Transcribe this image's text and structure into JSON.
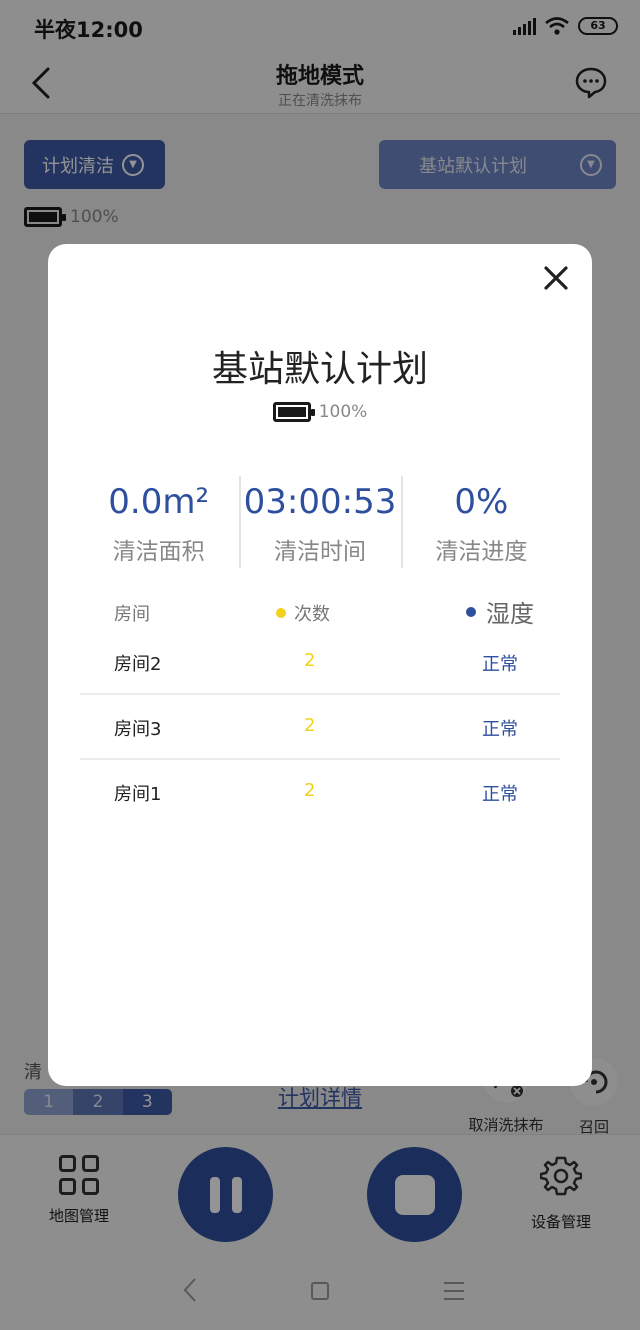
{
  "status_bar": {
    "time": "半夜12:00",
    "battery": "63"
  },
  "navbar": {
    "title": "拖地模式",
    "subtitle": "正在清洗抹布"
  },
  "top_controls": {
    "plan_clean_label": "计划清洁",
    "station_plan_label": "基站默认计划"
  },
  "device_battery": "100%",
  "bottom_section": {
    "clean_label": "清",
    "segments": [
      "1",
      "2",
      "3"
    ],
    "plan_detail_link": "计划详情",
    "cancel_mop_label": "取消洗抹布",
    "recall_label": "召回"
  },
  "bottom_bar": {
    "map_mgmt_label": "地图管理",
    "device_mgmt_label": "设备管理"
  },
  "modal": {
    "title": "基站默认计划",
    "battery": "100%",
    "stats": [
      {
        "value": "0.0m²",
        "label": "清洁面积"
      },
      {
        "value": "03:00:53",
        "label": "清洁时间"
      },
      {
        "value": "0%",
        "label": "清洁进度"
      }
    ],
    "table": {
      "headers": {
        "room": "房间",
        "times": "次数",
        "humidity": "湿度"
      },
      "rows": [
        {
          "room": "房间2",
          "times": "2",
          "humidity": "正常"
        },
        {
          "room": "房间3",
          "times": "2",
          "humidity": "正常"
        },
        {
          "room": "房间1",
          "times": "2",
          "humidity": "正常"
        }
      ]
    }
  },
  "colors": {
    "primary": "#2d4f9e",
    "button_blue": "#3d5aa8",
    "yellow": "#f2d21b"
  },
  "icons": [
    "back-icon",
    "chat-icon",
    "chevron-down-icon",
    "battery-icon",
    "close-icon",
    "mop-icon",
    "recall-icon",
    "map-grid-icon",
    "pause-icon",
    "stop-icon",
    "gear-icon"
  ]
}
